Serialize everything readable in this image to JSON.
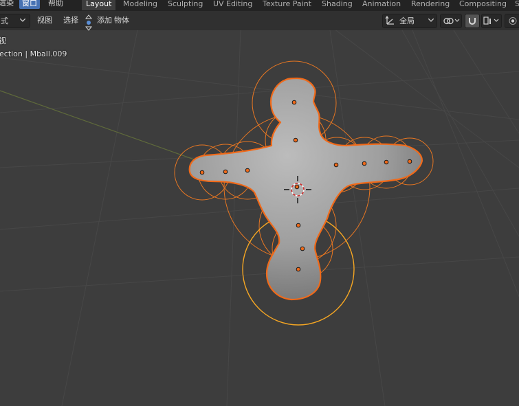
{
  "menu": {
    "items": [
      {
        "label": "渲染",
        "active": false
      },
      {
        "label": "窗口",
        "active": true
      },
      {
        "label": "帮助",
        "active": false
      }
    ]
  },
  "workspace_tabs": [
    {
      "label": "Layout",
      "active": true
    },
    {
      "label": "Modeling",
      "active": false
    },
    {
      "label": "Sculpting",
      "active": false
    },
    {
      "label": "UV Editing",
      "active": false
    },
    {
      "label": "Texture Paint",
      "active": false
    },
    {
      "label": "Shading",
      "active": false
    },
    {
      "label": "Animation",
      "active": false
    },
    {
      "label": "Rendering",
      "active": false
    },
    {
      "label": "Compositing",
      "active": false
    },
    {
      "label": "S",
      "active": false
    }
  ],
  "header": {
    "mode_dropdown_value": "式",
    "view_label": "视图",
    "select_label": "选择",
    "add_label": "添加",
    "object_label": "物体",
    "transform_orientation": "全局"
  },
  "viewport": {
    "view_name": "视",
    "collection_info": "ection | Mball.009"
  },
  "colors": {
    "selection_outline": "#f06a1a",
    "influence_circle": "#e87722",
    "active_circle": "#f5a623",
    "accent": "#4772b3"
  }
}
